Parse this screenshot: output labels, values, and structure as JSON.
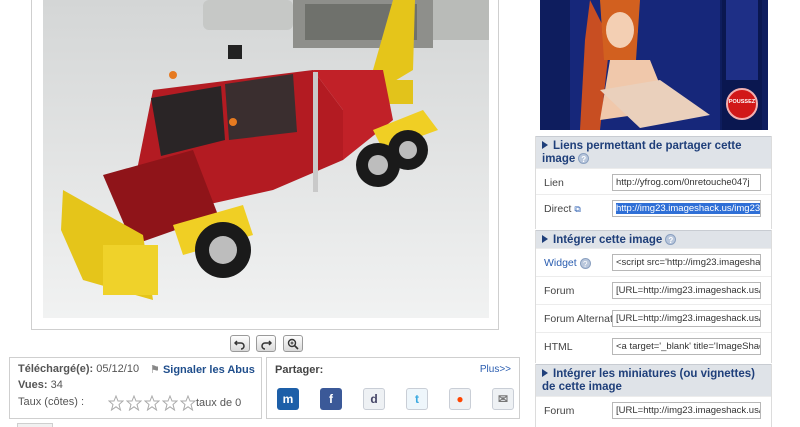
{
  "image_tools": {
    "rotate_left_icon": "rotate-left-icon",
    "rotate_right_icon": "rotate-right-icon",
    "zoom_icon": "zoom-icon"
  },
  "info": {
    "uploaded_label": "Téléchargé(e):",
    "uploaded_value": "05/12/10",
    "report_label": "Signaler les Abus",
    "views_label": "Vues:",
    "views_value": "34",
    "rating_label": "Taux (côtes) :",
    "rating_suffix": "taux de 0",
    "stars_count": 5,
    "stars_filled": 0
  },
  "share": {
    "title": "Partager:",
    "more": "Plus>>",
    "icons": [
      "myspace-icon",
      "facebook-icon",
      "digg-icon",
      "twitter-icon",
      "reddit-icon",
      "email-icon"
    ]
  },
  "ad": {
    "button_label": "POUSSEZ"
  },
  "share_links": {
    "header": "Liens permettant de partager cette image",
    "rows": [
      {
        "label": "Lien",
        "value": "http://yfrog.com/0nretouche047j"
      },
      {
        "label": "Direct",
        "value": "http://img23.imageshack.us/img23"
      }
    ]
  },
  "embed_image": {
    "header": "Intégrer cette image",
    "rows": [
      {
        "label": "Widget",
        "value": "<script src='http://img23.imagesha"
      },
      {
        "label": "Forum",
        "value": "[URL=http://img23.imageshack.us/"
      },
      {
        "label": "Forum Alternatif",
        "value": "[URL=http://img23.imageshack.us/"
      },
      {
        "label": "HTML",
        "value": "<a target='_blank' title='ImageShac"
      }
    ]
  },
  "embed_thumbs": {
    "header": "Intégrer les miniatures (ou vignettes) de cette image",
    "rows": [
      {
        "label": "Forum",
        "value": "[URL=http://img23.imageshack.us/"
      }
    ]
  },
  "colors": {
    "panel_header_bg": "#dfe3e8",
    "panel_header_text": "#1f3f7a",
    "link": "#2a5db0",
    "selection": "#2f6fd6"
  }
}
